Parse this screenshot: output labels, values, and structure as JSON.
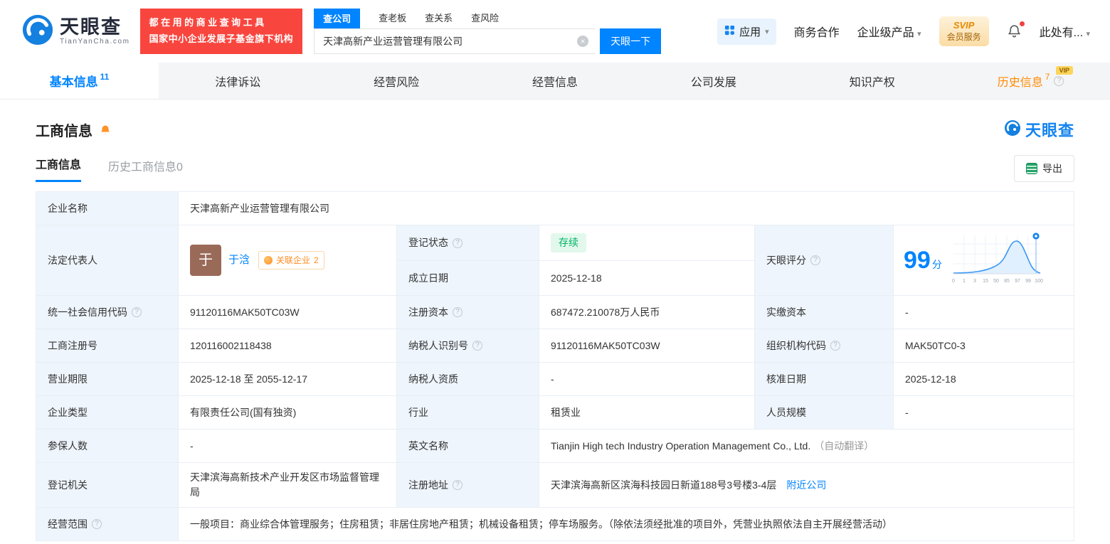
{
  "header": {
    "logo": {
      "name_cn": "天眼查",
      "name_en": "TianYanCha.com"
    },
    "promo": {
      "line1": "都在用的商业查询工具",
      "line2": "国家中小企业发展子基金旗下机构"
    },
    "search_tabs": [
      {
        "label": "查公司"
      },
      {
        "label": "查老板"
      },
      {
        "label": "查关系"
      },
      {
        "label": "查风险"
      }
    ],
    "search": {
      "value": "天津高新产业运营管理有限公司",
      "button": "天眼一下"
    },
    "nav_right": {
      "apps": "应用",
      "cooperation": "商务合作",
      "enterprise": "企业级产品",
      "svip_title": "SVIP",
      "svip_sub": "会员服务",
      "user": "此处有..."
    }
  },
  "nav_tabs": [
    {
      "label": "基本信息",
      "count": "11"
    },
    {
      "label": "法律诉讼"
    },
    {
      "label": "经营风险"
    },
    {
      "label": "经营信息"
    },
    {
      "label": "公司发展"
    },
    {
      "label": "知识产权"
    },
    {
      "label": "历史信息",
      "count": "7",
      "vip": "VIP"
    }
  ],
  "section": {
    "title": "工商信息",
    "watermark": "天眼查",
    "subtab_active": "工商信息",
    "subtab_history": "历史工商信息0",
    "export": "导出"
  },
  "company": {
    "name_label": "企业名称",
    "name": "天津高新产业运营管理有限公司",
    "legal_rep_label": "法定代表人",
    "legal_rep_avatar": "于",
    "legal_rep_name": "于浛",
    "related_badge": "关联企业",
    "related_count": "2",
    "status_label": "登记状态",
    "status": "存续",
    "established_label": "成立日期",
    "established": "2025-12-18",
    "score_label": "天眼评分",
    "score": "99",
    "score_unit": "分",
    "credit_code_label": "统一社会信用代码",
    "credit_code": "91120116MAK50TC03W",
    "reg_capital_label": "注册资本",
    "reg_capital": "687472.210078万人民币",
    "paid_capital_label": "实缴资本",
    "paid_capital": "-",
    "reg_no_label": "工商注册号",
    "reg_no": "120116002118438",
    "taxpayer_no_label": "纳税人识别号",
    "taxpayer_no": "91120116MAK50TC03W",
    "org_code_label": "组织机构代码",
    "org_code": "MAK50TC0-3",
    "term_label": "营业期限",
    "term": "2025-12-18 至 2055-12-17",
    "taxpayer_qual_label": "纳税人资质",
    "taxpayer_qual": "-",
    "approval_label": "核准日期",
    "approval": "2025-12-18",
    "type_label": "企业类型",
    "type": "有限责任公司(国有独资)",
    "industry_label": "行业",
    "industry": "租赁业",
    "staff_label": "人员规模",
    "staff": "-",
    "insured_label": "参保人数",
    "insured": "-",
    "en_name_label": "英文名称",
    "en_name": "Tianjin High tech Industry Operation Management Co., Ltd.",
    "en_name_note": "（自动翻译）",
    "authority_label": "登记机关",
    "authority": "天津滨海高新技术产业开发区市场监督管理局",
    "address_label": "注册地址",
    "address": "天津滨海高新区滨海科技园日新道188号3号楼3-4层",
    "nearby": "附近公司",
    "scope_label": "经营范围",
    "scope": "一般项目：商业综合体管理服务；住房租赁；非居住房地产租赁；机械设备租赁；停车场服务。（除依法须经批准的项目外，凭营业执照依法自主开展经营活动）"
  },
  "score_chart": {
    "type": "line",
    "ticks": [
      "0",
      "1",
      "3",
      "15",
      "50",
      "85",
      "97",
      "99",
      "100"
    ]
  }
}
